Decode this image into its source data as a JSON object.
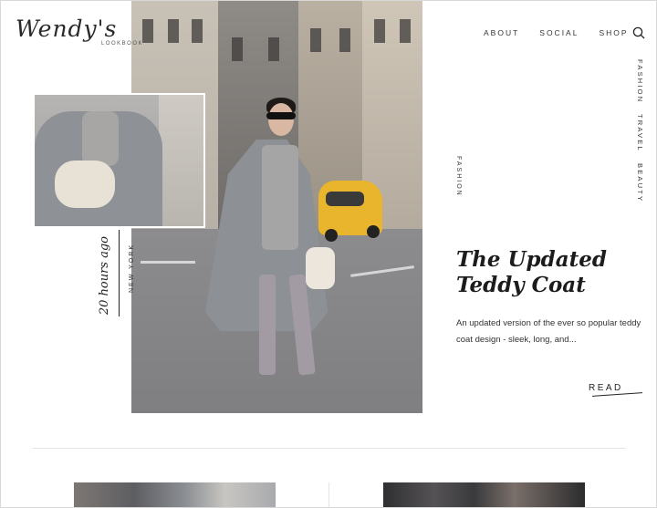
{
  "logo": {
    "script": "Wendy's",
    "sub": "LOOKBOOK"
  },
  "nav": {
    "items": [
      "ABOUT",
      "SOCIAL",
      "SHOP"
    ],
    "search_icon": "search-icon"
  },
  "side_nav": {
    "items": [
      "FASHION",
      "TRAVEL",
      "BEAUTY"
    ]
  },
  "post": {
    "date": "20 hours ago",
    "location": "NEW YORK",
    "category": "FASHION",
    "title": "The Updated Teddy Coat",
    "excerpt": "An updated version of the ever so popular teddy coat design - sleek, long, and...",
    "read_label": "READ"
  },
  "colors": {
    "text": "#222222",
    "taxi": "#e8b52c",
    "coat": "#8d9095"
  }
}
